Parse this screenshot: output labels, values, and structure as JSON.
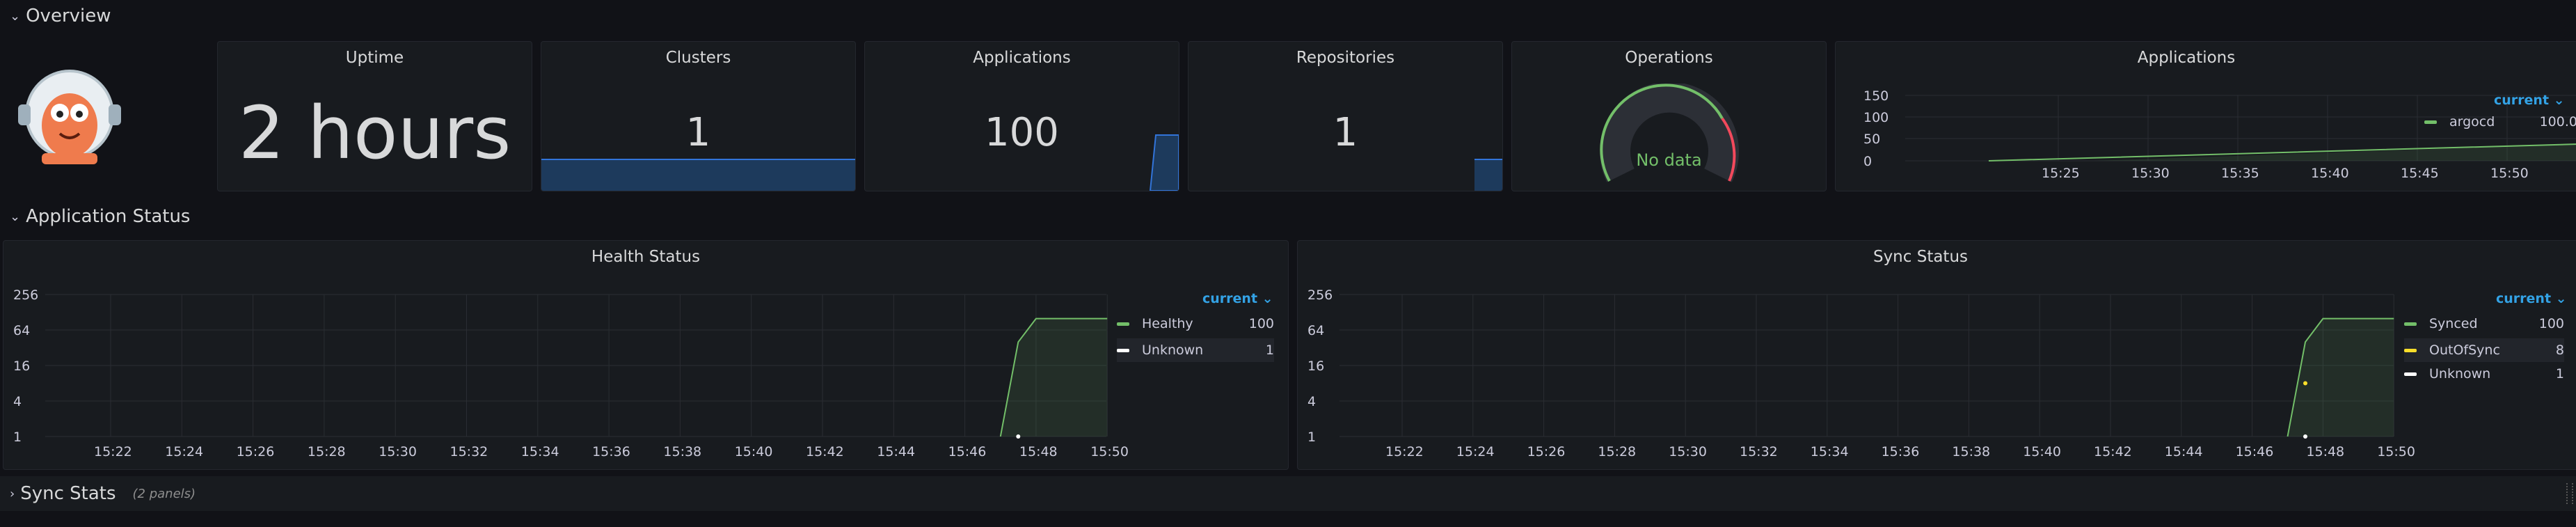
{
  "rows": {
    "overview": "Overview",
    "app_status": "Application Status",
    "sync_stats": "Sync Stats",
    "sync_stats_sub": "(2 panels)"
  },
  "stats": {
    "uptime": {
      "title": "Uptime",
      "value": "2 hours"
    },
    "clusters": {
      "title": "Clusters",
      "value": "1"
    },
    "applications": {
      "title": "Applications",
      "value": "100"
    },
    "repositories": {
      "title": "Repositories",
      "value": "1"
    },
    "operations": {
      "title": "Operations",
      "value": "No data"
    }
  },
  "apps_chart": {
    "title": "Applications",
    "legend_header": "current",
    "series_name": "argocd",
    "series_value": "100.0",
    "y_ticks": [
      "150",
      "100",
      "50",
      "0"
    ],
    "x_ticks": [
      "15:25",
      "15:30",
      "15:35",
      "15:40",
      "15:45",
      "15:50"
    ]
  },
  "health_chart": {
    "title": "Health Status",
    "legend_header": "current",
    "y_ticks": [
      "256",
      "64",
      "16",
      "4",
      "1"
    ],
    "x_ticks": [
      "15:22",
      "15:24",
      "15:26",
      "15:28",
      "15:30",
      "15:32",
      "15:34",
      "15:36",
      "15:38",
      "15:40",
      "15:42",
      "15:44",
      "15:46",
      "15:48",
      "15:50"
    ],
    "legend": [
      {
        "name": "Healthy",
        "value": "100"
      },
      {
        "name": "Unknown",
        "value": "1"
      }
    ]
  },
  "sync_chart": {
    "title": "Sync Status",
    "legend_header": "current",
    "y_ticks": [
      "256",
      "64",
      "16",
      "4",
      "1"
    ],
    "x_ticks": [
      "15:22",
      "15:24",
      "15:26",
      "15:28",
      "15:30",
      "15:32",
      "15:34",
      "15:36",
      "15:38",
      "15:40",
      "15:42",
      "15:44",
      "15:46",
      "15:48",
      "15:50"
    ],
    "legend": [
      {
        "name": "Synced",
        "value": "100"
      },
      {
        "name": "OutOfSync",
        "value": "8"
      },
      {
        "name": "Unknown",
        "value": "1"
      }
    ]
  },
  "colors": {
    "green": "#73bf69",
    "yellow": "#fade2a",
    "white": "#ffffff",
    "blue": "#33a2e5",
    "red": "#f2495c"
  },
  "chart_data": [
    {
      "type": "line",
      "title": "Applications",
      "ylim": [
        0,
        150
      ],
      "series": [
        {
          "name": "argocd",
          "x": [
            "15:26",
            "15:47",
            "15:48",
            "15:50"
          ],
          "values": [
            0,
            20,
            100,
            100
          ]
        }
      ]
    },
    {
      "type": "line",
      "title": "Health Status",
      "yscale": "log2",
      "series": [
        {
          "name": "Healthy",
          "x": [
            "15:47",
            "15:47:30",
            "15:48",
            "15:50"
          ],
          "values": [
            1,
            40,
            100,
            100
          ]
        },
        {
          "name": "Unknown",
          "x": [
            "15:47:30"
          ],
          "values": [
            1
          ]
        }
      ]
    },
    {
      "type": "line",
      "title": "Sync Status",
      "yscale": "log2",
      "series": [
        {
          "name": "Synced",
          "x": [
            "15:47",
            "15:47:30",
            "15:48",
            "15:50"
          ],
          "values": [
            1,
            40,
            100,
            100
          ]
        },
        {
          "name": "OutOfSync",
          "x": [
            "15:47:30"
          ],
          "values": [
            8
          ]
        },
        {
          "name": "Unknown",
          "x": [
            "15:47:30"
          ],
          "values": [
            1
          ]
        }
      ]
    }
  ]
}
